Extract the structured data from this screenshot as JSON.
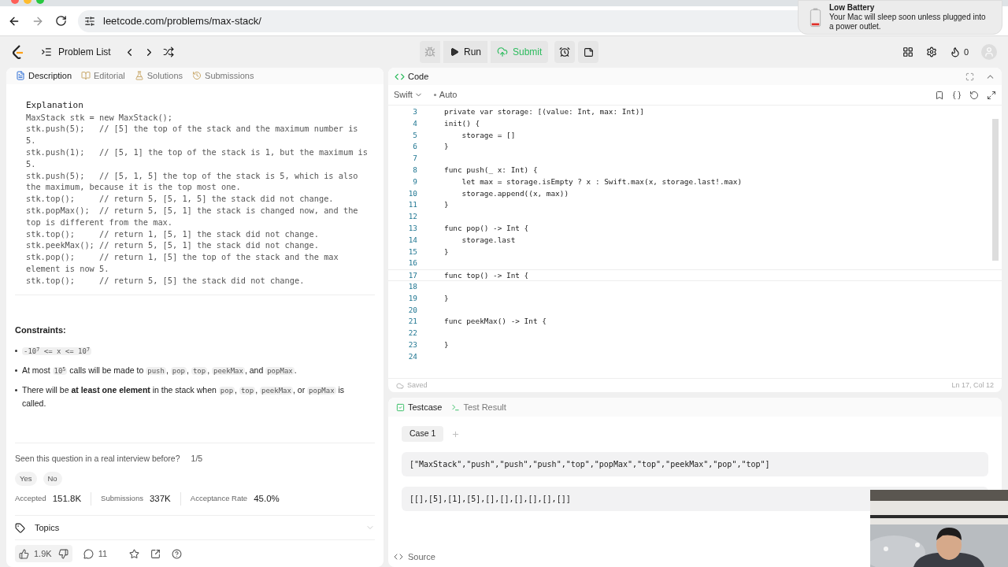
{
  "browser": {
    "url": "leetcode.com/problems/max-stack/"
  },
  "notification": {
    "title": "Low Battery",
    "message": "Your Mac will sleep soon unless plugged into a power outlet."
  },
  "toolbar": {
    "problem_list": "Problem List",
    "run": "Run",
    "submit": "Submit",
    "streak": "0"
  },
  "description_tabs": [
    {
      "label": "Description",
      "selected": true
    },
    {
      "label": "Editorial",
      "selected": false
    },
    {
      "label": "Solutions",
      "selected": false
    },
    {
      "label": "Submissions",
      "selected": false
    }
  ],
  "example": {
    "heading": "Explanation",
    "lines": [
      "MaxStack stk = new MaxStack();",
      "stk.push(5);   // [5] the top of the stack and the maximum number is 5.",
      "stk.push(1);   // [5, 1] the top of the stack is 1, but the maximum is 5.",
      "stk.push(5);   // [5, 1, 5] the top of the stack is 5, which is also the maximum, because it is the top most one.",
      "stk.top();     // return 5, [5, 1, 5] the stack did not change.",
      "stk.popMax();  // return 5, [5, 1] the stack is changed now, and the top is different from the max.",
      "stk.top();     // return 1, [5, 1] the stack did not change.",
      "stk.peekMax(); // return 5, [5, 1] the stack did not change.",
      "stk.pop();     // return 1, [5] the top of the stack and the max element is now 5.",
      "stk.top();     // return 5, [5] the stack did not change."
    ]
  },
  "constraints": {
    "heading": "Constraints:",
    "items": [
      [
        {
          "kind": "code",
          "text": "-10$^{7}$ <= x <= 10$^{7}$"
        }
      ],
      [
        {
          "kind": "text",
          "text": "At most "
        },
        {
          "kind": "code",
          "text": "10$^{5}$"
        },
        {
          "kind": "text",
          "text": " calls will be made to "
        },
        {
          "kind": "code",
          "text": "push"
        },
        {
          "kind": "text",
          "text": ", "
        },
        {
          "kind": "code",
          "text": "pop"
        },
        {
          "kind": "text",
          "text": ", "
        },
        {
          "kind": "code",
          "text": "top"
        },
        {
          "kind": "text",
          "text": ", "
        },
        {
          "kind": "code",
          "text": "peekMax"
        },
        {
          "kind": "text",
          "text": ", and "
        },
        {
          "kind": "code",
          "text": "popMax"
        },
        {
          "kind": "text",
          "text": "."
        }
      ],
      [
        {
          "kind": "text",
          "text": "There will be **at least one element** in the stack when "
        },
        {
          "kind": "code",
          "text": "pop"
        },
        {
          "kind": "text",
          "text": ", "
        },
        {
          "kind": "code",
          "text": "top"
        },
        {
          "kind": "text",
          "text": ", "
        },
        {
          "kind": "code",
          "text": "peekMax"
        },
        {
          "kind": "text",
          "text": ", or "
        },
        {
          "kind": "code",
          "text": "popMax"
        },
        {
          "kind": "text",
          "text": " is called."
        }
      ]
    ]
  },
  "interview": {
    "question": "Seen this question in a real interview before?",
    "ratio": "1/5",
    "answers": [
      "Yes",
      "No"
    ]
  },
  "stats": [
    {
      "label": "Accepted",
      "value": "151.8K"
    },
    {
      "label": "Submissions",
      "value": "337K"
    },
    {
      "label": "Acceptance Rate",
      "value": "45.0%"
    }
  ],
  "topics": "Topics",
  "footer": {
    "likes": "1.9K",
    "comments": "11"
  },
  "code_panel": {
    "title": "Code",
    "language": "Swift",
    "mode": "Auto",
    "status": "Saved",
    "cursor": "Ln 17, Col 12",
    "lines": [
      {
        "n": "3",
        "text": "private var storage: [(value: Int, max: Int)]",
        "current": false
      },
      {
        "n": "4",
        "text": "init() {",
        "current": false
      },
      {
        "n": "5",
        "text": "    storage = []",
        "current": false
      },
      {
        "n": "6",
        "text": "}",
        "current": false
      },
      {
        "n": "7",
        "current": false
      },
      {
        "n": "8",
        "text": "func push(_ x: Int) {",
        "current": false
      },
      {
        "n": "9",
        "text": "    let max = storage.isEmpty ? x : Swift.max(x, storage.last!.max)",
        "current": false
      },
      {
        "n": "10",
        "text": "    storage.append((x, max))",
        "current": false
      },
      {
        "n": "11",
        "text": "}",
        "current": false
      },
      {
        "n": "12",
        "current": false
      },
      {
        "n": "13",
        "text": "func pop() -> Int {",
        "current": false
      },
      {
        "n": "14",
        "text": "    storage.last",
        "current": false
      },
      {
        "n": "15",
        "text": "}",
        "current": false
      },
      {
        "n": "16",
        "current": false
      },
      {
        "n": "17",
        "text": "func top() -> Int {",
        "current": true
      },
      {
        "n": "18",
        "current": false
      },
      {
        "n": "19",
        "text": "}",
        "current": false
      },
      {
        "n": "20",
        "current": false
      },
      {
        "n": "21",
        "text": "func peekMax() -> Int {",
        "current": false
      },
      {
        "n": "22",
        "current": false
      },
      {
        "n": "23",
        "text": "}",
        "current": false
      },
      {
        "n": "24",
        "current": false
      }
    ]
  },
  "test_tabs": [
    {
      "label": "Testcase",
      "selected": true
    },
    {
      "label": "Test Result",
      "selected": false
    }
  ],
  "cases": [
    {
      "label": "Case 1",
      "selected": true
    }
  ],
  "inputs": [
    "[\"MaxStack\",\"push\",\"push\",\"push\",\"top\",\"popMax\",\"top\",\"peekMax\",\"pop\",\"top\"]",
    "[[],[5],[1],[5],[],[],[],[],[],[]]"
  ],
  "source": "Source",
  "webcam": {
    "kind": "picture"
  }
}
